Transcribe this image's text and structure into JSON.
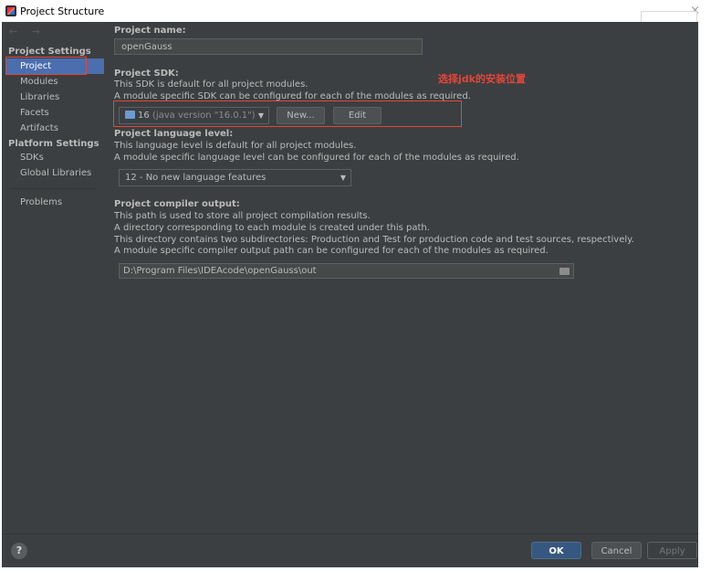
{
  "window": {
    "title": "Project Structure",
    "close_symbol": "×"
  },
  "nav": {
    "arrows": "← →"
  },
  "sidebar": {
    "project_settings_header": "Project Settings",
    "project_settings_items": [
      {
        "label": "Project"
      },
      {
        "label": "Modules"
      },
      {
        "label": "Libraries"
      },
      {
        "label": "Facets"
      },
      {
        "label": "Artifacts"
      }
    ],
    "platform_settings_header": "Platform Settings",
    "platform_settings_items": [
      {
        "label": "SDKs"
      },
      {
        "label": "Global Libraries"
      }
    ],
    "problems_label": "Problems"
  },
  "project_name": {
    "label": "Project name:",
    "value": "openGauss"
  },
  "project_sdk": {
    "label": "Project SDK:",
    "desc1": "This SDK is default for all project modules.",
    "desc2": "A module specific SDK can be configured for each of the modules as required.",
    "selected_version": "16",
    "selected_detail": "(java version \"16.0.1\")",
    "new_button": "New...",
    "edit_button": "Edit",
    "annotation": "选择jdk的安装位置"
  },
  "language_level": {
    "label": "Project language level:",
    "desc1": "This language level is default for all project modules.",
    "desc2": "A module specific language level can be configured for each of the modules as required.",
    "selected": "12 - No new language features"
  },
  "compiler_output": {
    "label": "Project compiler output:",
    "desc1": "This path is used to store all project compilation results.",
    "desc2": "A directory corresponding to each module is created under this path.",
    "desc3": "This directory contains two subdirectories: Production and Test for production code and test sources, respectively.",
    "desc4": "A module specific compiler output path can be configured for each of the modules as required.",
    "path": "D:\\Program Files\\IDEAcode\\openGauss\\out"
  },
  "footer": {
    "help": "?",
    "ok": "OK",
    "cancel": "Cancel",
    "apply": "Apply"
  },
  "icons": {
    "app": "intellij-icon",
    "sdk": "jdk-folder-icon",
    "folder": "folder-icon",
    "image": "image-icon",
    "dropdown": "chevron-down-icon"
  },
  "colors": {
    "background": "#3c3f41",
    "selection": "#4b6eaf",
    "annotation": "#e2463b",
    "ok_button": "#365880"
  }
}
